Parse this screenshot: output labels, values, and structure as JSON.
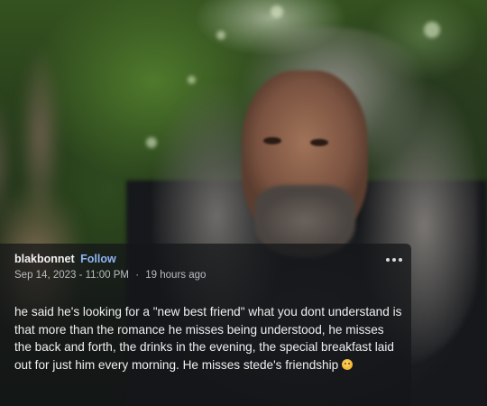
{
  "post": {
    "username": "blakbonnet",
    "follow_label": "Follow",
    "date": "Sep 14, 2023 - 11:00 PM",
    "separator": "·",
    "relative_time": "19 hours ago",
    "body": "he said he's looking for a \"new best friend\" what you dont understand is that more than the romance he misses being understood, he misses the back and forth, the drinks in the evening, the special breakfast laid out for just him every morning. He misses stede's friendship",
    "trailing_emoji": "sad-face-emoji",
    "more_icon": "more-options-icon"
  },
  "colors": {
    "card_background": "rgba(20,22,24,0.74)",
    "follow_link": "#8fb4f5",
    "meta_text": "#b9bcc0",
    "body_text": "#f0f0f0"
  }
}
